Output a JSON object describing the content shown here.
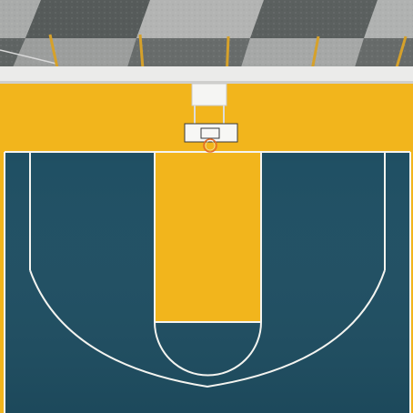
{
  "scene": {
    "subject": "aerial-basketball-court",
    "colors": {
      "court_blue": "#1f4f63",
      "court_blue_dark": "#1a4557",
      "court_yellow": "#f2b51c",
      "court_yellow_shadow": "#e5a915",
      "line_white": "#f4f4f0",
      "concrete_light": "#b8b9b7",
      "concrete_mid": "#8e908f",
      "concrete_dark": "#5f6463",
      "wall_white": "#ebebea",
      "post_yellow": "#d6a12a",
      "rim_orange": "#e46a2b"
    }
  }
}
